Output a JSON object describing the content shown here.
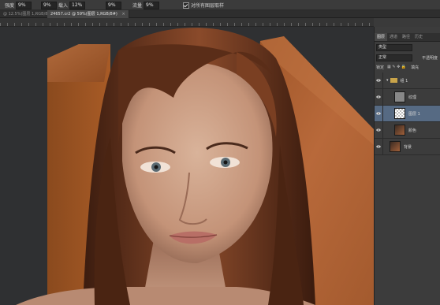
{
  "options_bar": {
    "field1": {
      "label": "强度",
      "value": "9%"
    },
    "field2": {
      "label": "",
      "value": "9%"
    },
    "field3": {
      "label": "载入",
      "value": "12%"
    },
    "field4": {
      "label": "",
      "value": "9%"
    },
    "field5": {
      "label": "流量",
      "value": "9%"
    },
    "checkbox_label": "对所有图层取样"
  },
  "doc_tabs": [
    {
      "label": "@ 12.5%(图层 1,RGB/8)",
      "active": false
    },
    {
      "label": "24657.cr2 @ 59%(图层 1,RGB/8#)",
      "active": true
    }
  ],
  "layers_panel": {
    "tabs": [
      "图层",
      "通道",
      "路径",
      "历史"
    ],
    "kind_filter": "类型",
    "blend_mode": "正常",
    "opacity_label": "不透明度",
    "lock_label": "锁定",
    "fill_label": "填充",
    "layers": [
      {
        "name": "组 1",
        "kind": "group"
      },
      {
        "name": "纹理",
        "kind": "blank"
      },
      {
        "name": "图层 1",
        "kind": "transparent",
        "selected": true
      },
      {
        "name": "颜色",
        "kind": "photo"
      },
      {
        "name": "背景",
        "kind": "photo"
      }
    ]
  },
  "colors": {
    "panel_bg": "#3c3c3c",
    "selected_layer": "#566a83",
    "canvas_bg": "#2f3032"
  }
}
